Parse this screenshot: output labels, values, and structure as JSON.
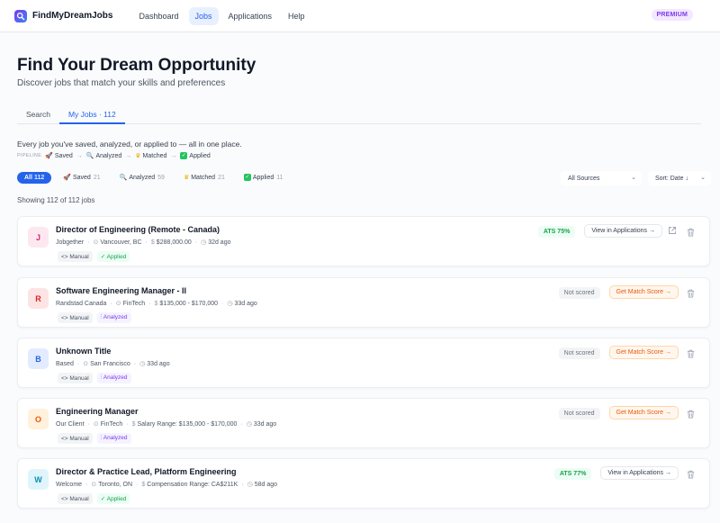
{
  "app": {
    "brand": "FindMyDreamJobs",
    "premium": "PREMIUM"
  },
  "nav": [
    {
      "label": "Dashboard",
      "active": false
    },
    {
      "label": "Jobs",
      "active": true
    },
    {
      "label": "Applications",
      "active": false
    },
    {
      "label": "Help",
      "active": false
    }
  ],
  "header": {
    "title": "Find Your Dream Opportunity",
    "subtitle": "Discover jobs that match your skills and preferences"
  },
  "tabs": [
    {
      "label": "Search",
      "active": false
    },
    {
      "label": "My Jobs · 112",
      "active": true
    }
  ],
  "description": "Every job you've saved, analyzed, or applied to — all in one place.",
  "pipeline": {
    "label": "PIPELINE",
    "steps": [
      "Saved",
      "Analyzed",
      "Matched",
      "Applied"
    ],
    "arrow": "→"
  },
  "filters": [
    {
      "label": "All",
      "count": "112",
      "active": true
    },
    {
      "label": "Saved",
      "count": "21",
      "active": false
    },
    {
      "label": "Analyzed",
      "count": "59",
      "active": false
    },
    {
      "label": "Matched",
      "count": "21",
      "active": false
    },
    {
      "label": "Applied",
      "count": "11",
      "active": false
    }
  ],
  "source_select": {
    "value": "All Sources"
  },
  "sort_select": {
    "value": "Sort: Date ↓"
  },
  "showing": "Showing 112 of 112 jobs",
  "jobs": [
    {
      "initial": "J",
      "avatar_bg": "#fde8ef",
      "avatar_fg": "#db2777",
      "title": "Director of Engineering (Remote - Canada)",
      "meta": [
        {
          "icon": "",
          "text": "Jobgether"
        },
        {
          "icon": "⊙",
          "text": "Vancouver, BC"
        },
        {
          "icon": "$",
          "text": "$288,000.00"
        },
        {
          "icon": "◷",
          "text": "32d ago"
        }
      ],
      "tags": [
        {
          "kind": "manual",
          "text": "<> Manual"
        },
        {
          "kind": "applied",
          "text": "✓ Applied"
        }
      ],
      "score": "ATS 75%",
      "scored": true,
      "action": "View in Applications →",
      "external_link": true
    },
    {
      "initial": "R",
      "avatar_bg": "#fde4e4",
      "avatar_fg": "#dc2626",
      "title": "Software Engineering Manager - II",
      "meta": [
        {
          "icon": "",
          "text": "Randstad Canada"
        },
        {
          "icon": "⊙",
          "text": "FinTech"
        },
        {
          "icon": "$",
          "text": "$135,000 - $170,000"
        },
        {
          "icon": "◷",
          "text": "33d ago"
        }
      ],
      "tags": [
        {
          "kind": "manual",
          "text": "<> Manual"
        },
        {
          "kind": "analyzed",
          "text": "⫶ Analyzed"
        }
      ],
      "score": "Not scored",
      "scored": false,
      "action": "Get Match Score →",
      "external_link": false
    },
    {
      "initial": "B",
      "avatar_bg": "#e3ecff",
      "avatar_fg": "#2563eb",
      "title": "Unknown Title",
      "meta": [
        {
          "icon": "",
          "text": "Based"
        },
        {
          "icon": "⊙",
          "text": "San Francisco"
        },
        {
          "icon": "◷",
          "text": "33d ago"
        }
      ],
      "tags": [
        {
          "kind": "manual",
          "text": "<> Manual"
        },
        {
          "kind": "analyzed",
          "text": "⫶ Analyzed"
        }
      ],
      "score": "Not scored",
      "scored": false,
      "action": "Get Match Score →",
      "external_link": false
    },
    {
      "initial": "O",
      "avatar_bg": "#fff1db",
      "avatar_fg": "#ea580c",
      "title": "Engineering Manager",
      "meta": [
        {
          "icon": "",
          "text": "Our Client"
        },
        {
          "icon": "⊙",
          "text": "FinTech"
        },
        {
          "icon": "$",
          "text": "Salary Range: $135,000 - $170,000"
        },
        {
          "icon": "◷",
          "text": "33d ago"
        }
      ],
      "tags": [
        {
          "kind": "manual",
          "text": "<> Manual"
        },
        {
          "kind": "analyzed",
          "text": "⫶ Analyzed"
        }
      ],
      "score": "Not scored",
      "scored": false,
      "action": "Get Match Score →",
      "external_link": false
    },
    {
      "initial": "W",
      "avatar_bg": "#dff5fb",
      "avatar_fg": "#0891b2",
      "title": "Director & Practice Lead, Platform Engineering",
      "meta": [
        {
          "icon": "",
          "text": "Welcome"
        },
        {
          "icon": "⊙",
          "text": "Toronto, ON"
        },
        {
          "icon": "$",
          "text": "Compensation Range: CA$211K"
        },
        {
          "icon": "◷",
          "text": "58d ago"
        }
      ],
      "tags": [
        {
          "kind": "manual",
          "text": "<> Manual"
        },
        {
          "kind": "applied",
          "text": "✓ Applied"
        }
      ],
      "score": "ATS 77%",
      "scored": true,
      "action": "View in Applications →",
      "external_link": false
    }
  ]
}
